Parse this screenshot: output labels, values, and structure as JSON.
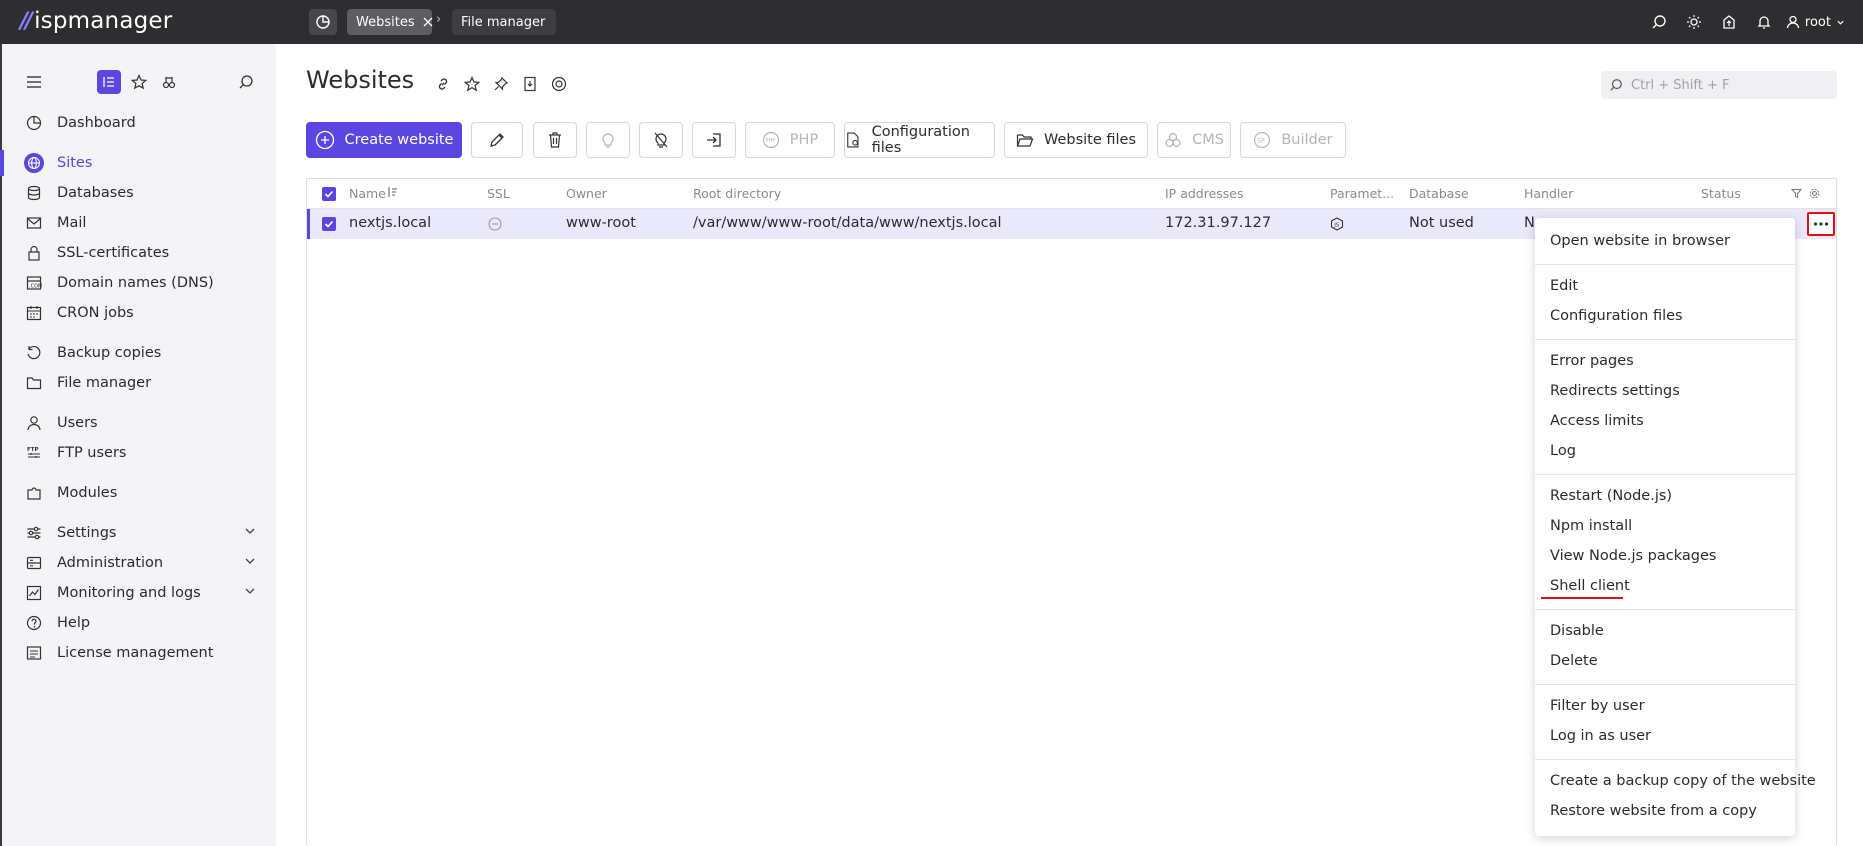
{
  "topbar": {
    "logo_text": "ispmanager",
    "tabs": [
      {
        "label": "Websites",
        "active": true
      },
      {
        "label": "File manager",
        "active": false
      }
    ],
    "user": "root"
  },
  "sidebar": {
    "items": [
      {
        "label": "Dashboard"
      },
      {
        "label": "Sites",
        "active": true
      },
      {
        "label": "Databases"
      },
      {
        "label": "Mail"
      },
      {
        "label": "SSL-certificates"
      },
      {
        "label": "Domain names (DNS)"
      },
      {
        "label": "CRON jobs"
      },
      {
        "label": "Backup copies"
      },
      {
        "label": "File manager"
      },
      {
        "label": "Users"
      },
      {
        "label": "FTP users"
      },
      {
        "label": "Modules"
      },
      {
        "label": "Settings"
      },
      {
        "label": "Administration"
      },
      {
        "label": "Monitoring and logs"
      },
      {
        "label": "Help"
      },
      {
        "label": "License management"
      }
    ]
  },
  "page": {
    "title": "Websites",
    "search_placeholder": "Ctrl + Shift + F"
  },
  "toolbar": {
    "create": "Create website",
    "php": "PHP",
    "config_files": "Configuration files",
    "website_files": "Website files",
    "cms": "CMS",
    "builder": "Builder"
  },
  "table": {
    "columns": [
      "Name",
      "SSL",
      "Owner",
      "Root directory",
      "IP addresses",
      "Paramet...",
      "Database",
      "Handler",
      "Status"
    ],
    "rows": [
      {
        "name": "nextjs.local",
        "owner": "www-root",
        "root": "/var/www/www-root/data/www/nextjs.local",
        "ip": "172.31.97.127",
        "database": "Not used",
        "handler": "N"
      }
    ]
  },
  "menu": {
    "items": [
      "Open website in browser",
      "Edit",
      "Configuration files",
      "Error pages",
      "Redirects settings",
      "Access limits",
      "Log",
      "Restart (Node.js)",
      "Npm install",
      "View Node.js packages",
      "Shell client",
      "Disable",
      "Delete",
      "Filter by user",
      "Log in as user",
      "Create a backup copy of the website",
      "Restore website from a copy"
    ]
  },
  "colors": {
    "accent": "#5a46e0",
    "topbar": "#2e2e31",
    "highlight": "#e0101a"
  }
}
